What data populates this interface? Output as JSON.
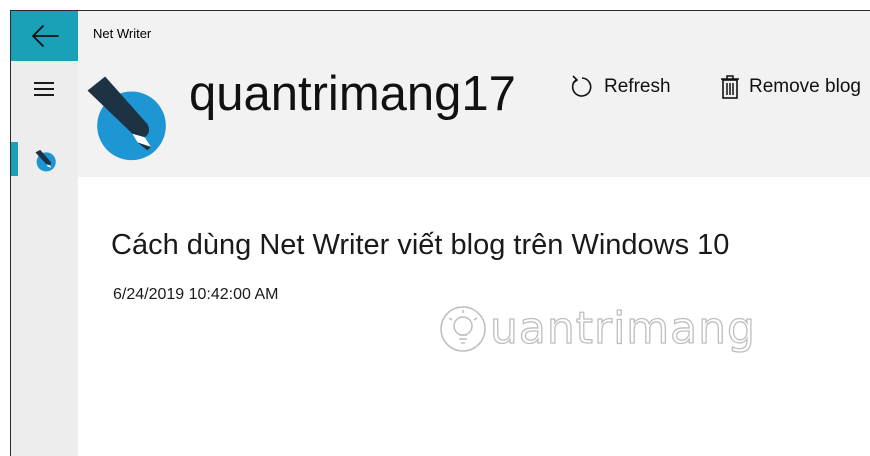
{
  "app": {
    "title": "Net Writer"
  },
  "blog": {
    "name": "quantrimang17"
  },
  "commands": {
    "refresh_label": "Refresh",
    "remove_label": "Remove blog"
  },
  "post": {
    "title": "Cách dùng Net Writer viết blog trên Windows 10",
    "date": "6/24/2019 10:42:00 AM"
  },
  "watermark": {
    "text": "uantrimang"
  },
  "colors": {
    "accent": "#1aa1b8",
    "logo_blue": "#1e96d4",
    "pen_dark": "#1d3344",
    "chrome_gray": "#f2f2f2",
    "nav_gray": "#ededed"
  },
  "icons": {
    "back": "back-arrow-icon",
    "menu": "hamburger-icon",
    "blog": "blog-pen-icon",
    "refresh": "refresh-icon",
    "remove": "trash-icon",
    "watermark": "lightbulb-icon"
  }
}
